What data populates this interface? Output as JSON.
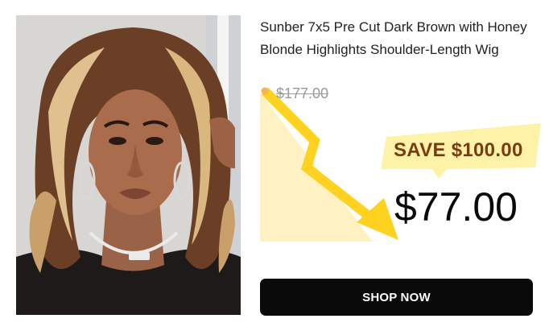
{
  "product": {
    "title": "Sunber 7x5 Pre Cut Dark Brown with Honey Blonde Highlights Shoulder-Length Wig",
    "original_price": "$177.00",
    "save_label": "SAVE $100.00",
    "sale_price": "$77.00",
    "cta_label": "SHOP NOW"
  },
  "colors": {
    "badge": "#fdf2a8",
    "arrow": "#ffd21f",
    "price_bg": "#fff1c2",
    "button": "#0a0a0a"
  }
}
